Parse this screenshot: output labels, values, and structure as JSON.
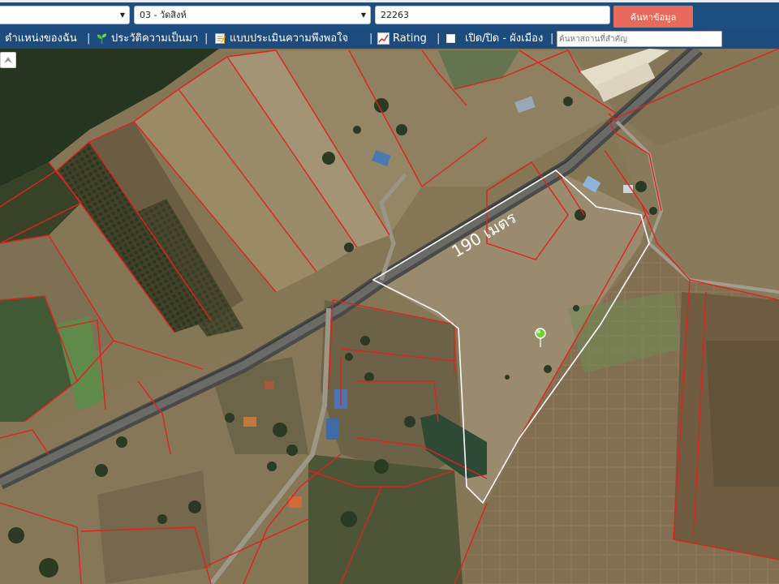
{
  "search": {
    "province_value": "",
    "tambon_value": "03 - วัดสิงห์",
    "parcel_value": "22263",
    "button_label": "ค้นหาข้อมูล",
    "place_placeholder": "ค้นหาสถานที่สำคัญ"
  },
  "menu": {
    "items": [
      {
        "label": "ตำแหน่งของฉัน",
        "icon": "location-icon"
      },
      {
        "label": "ประวัติความเป็นมา",
        "icon": "sprout-icon"
      },
      {
        "label": "แบบประเมินความพึงพอใจ",
        "icon": "memo-icon"
      },
      {
        "label": "Rating",
        "icon": "chart-icon"
      },
      {
        "label": "เปิด/ปิด - ผังเมือง",
        "icon": "checkbox-icon"
      }
    ],
    "separator": "|"
  },
  "map": {
    "measure_label": "190 เมตร",
    "parcel_color": "#e0221f",
    "highlight_color": "#ffffff",
    "marker_color": "#6dd23a"
  }
}
